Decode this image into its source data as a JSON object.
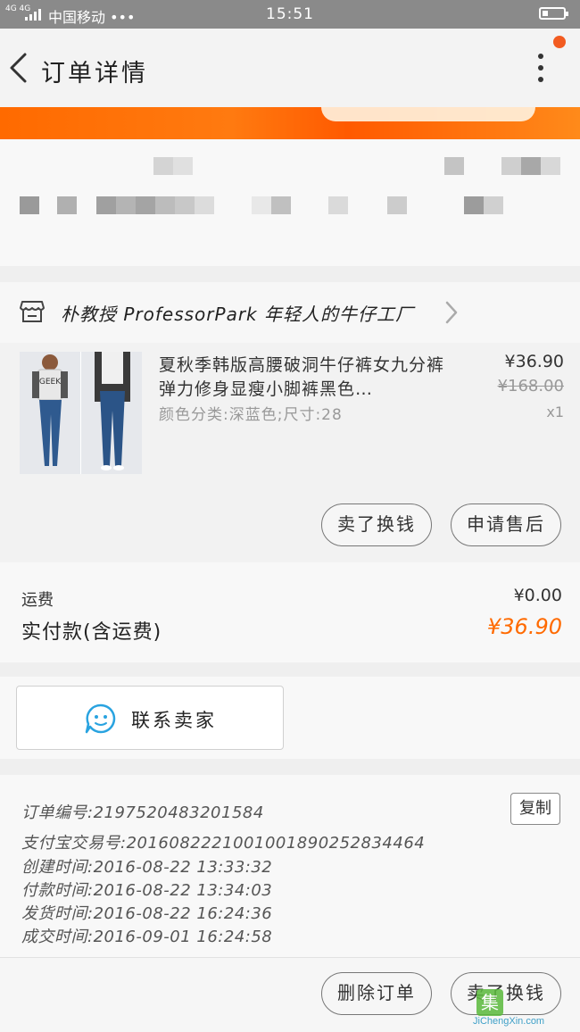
{
  "status_bar": {
    "network": "4G 4G",
    "carrier": "中国移动 •••",
    "time": "15:51"
  },
  "nav": {
    "title": "订单详情"
  },
  "shop": {
    "name": "朴教授 ProfessorPark 年轻人的牛仔工厂"
  },
  "product": {
    "title": "夏秋季韩版高腰破洞牛仔裤女九分裤弹力修身显瘦小脚裤黑色…",
    "spec": "颜色分类:深蓝色;尺寸:28",
    "price": "¥36.90",
    "original_price": "¥168.00",
    "quantity": "x1",
    "thumbnail_shirt_text": "GEEK"
  },
  "product_actions": {
    "sell_button": "卖了换钱",
    "after_sale_button": "申请售后"
  },
  "fees": {
    "shipping_label": "运费",
    "shipping_value": "¥0.00",
    "paid_label": "实付款(含运费)",
    "paid_value": "¥36.90"
  },
  "contact": {
    "label": "联系卖家"
  },
  "order_info": {
    "order_no": "订单编号:2197520483201584",
    "copy_button": "复制",
    "alipay_no": "支付宝交易号:2016082221001001890252834464",
    "created": "创建时间:2016-08-22 13:33:32",
    "paid": "付款时间:2016-08-22 13:34:03",
    "shipped": "发货时间:2016-08-22 16:24:36",
    "completed": "成交时间:2016-09-01 16:24:58"
  },
  "bottom_actions": {
    "delete_button": "删除订单",
    "sell_button": "卖了换钱"
  },
  "watermark": {
    "site": "JiChengXin.com",
    "badge": "集"
  },
  "colors": {
    "accent": "#ff6a00",
    "status_bar": "#8a8a8a",
    "chat_blue": "#29a3e0"
  }
}
